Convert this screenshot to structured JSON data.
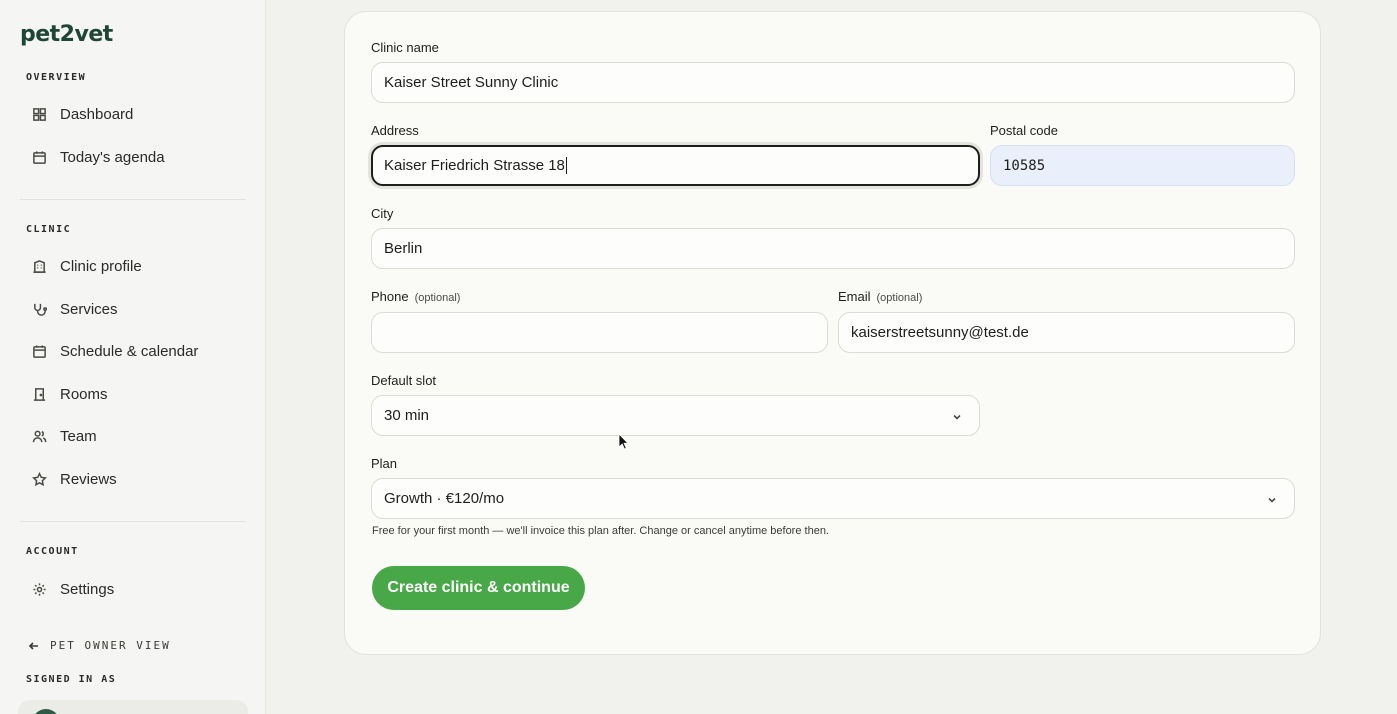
{
  "brand": {
    "logo": "pet2vet"
  },
  "sidebar": {
    "sections": [
      {
        "title": "OVERVIEW",
        "items": [
          {
            "label": "Dashboard",
            "icon": "dashboard-icon"
          },
          {
            "label": "Today's agenda",
            "icon": "calendar-icon"
          }
        ]
      },
      {
        "title": "CLINIC",
        "items": [
          {
            "label": "Clinic profile",
            "icon": "building-icon"
          },
          {
            "label": "Services",
            "icon": "stethoscope-icon"
          },
          {
            "label": "Schedule & calendar",
            "icon": "calendar-icon"
          },
          {
            "label": "Rooms",
            "icon": "door-icon"
          },
          {
            "label": "Team",
            "icon": "users-icon"
          },
          {
            "label": "Reviews",
            "icon": "star-icon"
          }
        ]
      },
      {
        "title": "ACCOUNT",
        "items": [
          {
            "label": "Settings",
            "icon": "gear-icon"
          }
        ]
      }
    ],
    "pet_owner_view": "PET OWNER VIEW",
    "signed_in_as": "SIGNED IN AS"
  },
  "form": {
    "clinic_name": {
      "label": "Clinic name",
      "value": "Kaiser Street Sunny Clinic"
    },
    "address": {
      "label": "Address",
      "value": "Kaiser Friedrich Strasse 18"
    },
    "postal_code": {
      "label": "Postal code",
      "value": "10585"
    },
    "city": {
      "label": "City",
      "value": "Berlin"
    },
    "phone": {
      "label": "Phone",
      "optional": "(optional)",
      "value": ""
    },
    "email": {
      "label": "Email",
      "optional": "(optional)",
      "value": "kaiserstreetsunny@test.de"
    },
    "default_slot": {
      "label": "Default slot",
      "value": "30 min"
    },
    "plan": {
      "label": "Plan",
      "value": "Growth · €120/mo"
    },
    "plan_hint": "Free for your first month — we'll invoice this plan after. Change or cancel anytime before then.",
    "submit_label": "Create clinic & continue"
  },
  "colors": {
    "accent": "#48a848",
    "brand": "#1e4636",
    "autofill": "#e9f0fb"
  }
}
